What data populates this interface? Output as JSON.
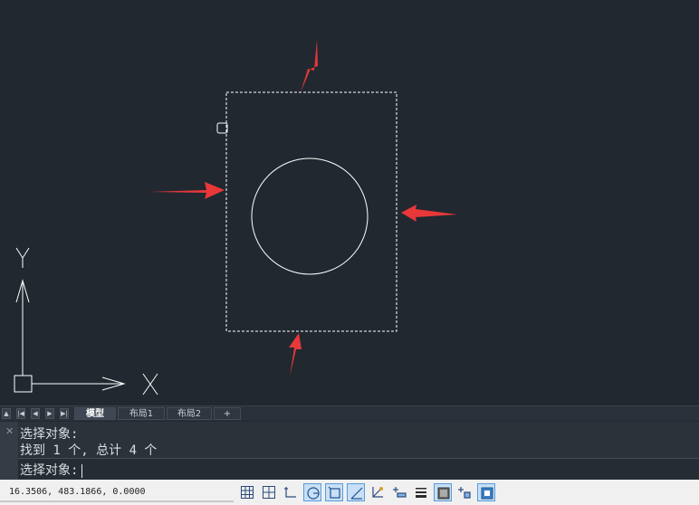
{
  "canvas": {
    "background": "#212830",
    "axis_x_label": "X",
    "axis_y_label": "Y"
  },
  "tabs": {
    "items": [
      "模型",
      "布局1",
      "布局2",
      "+"
    ],
    "active": "模型"
  },
  "command": {
    "history": [
      "选择对象:",
      "找到 1 个, 总计 4 个"
    ],
    "prompt": "选择对象:"
  },
  "status": {
    "coordinates": "16.3506, 483.1866, 0.0000",
    "buttons": [
      {
        "name": "grid-display",
        "icon": "grid-icon",
        "on": false
      },
      {
        "name": "snap-mode",
        "icon": "snap-grid-icon",
        "on": false
      },
      {
        "name": "ortho-mode",
        "icon": "ortho-icon",
        "on": false
      },
      {
        "name": "polar-tracking",
        "icon": "polar-icon",
        "on": true
      },
      {
        "name": "object-snap",
        "icon": "osnap-icon",
        "on": true
      },
      {
        "name": "object-snap-tracking",
        "icon": "otrack-icon",
        "on": true
      },
      {
        "name": "dynamic-ucs",
        "icon": "ducs-icon",
        "on": false
      },
      {
        "name": "dynamic-input",
        "icon": "dyn-input-icon",
        "on": false
      },
      {
        "name": "lineweight",
        "icon": "lineweight-icon",
        "on": false
      },
      {
        "name": "transparency",
        "icon": "transparency-icon",
        "on": true
      },
      {
        "name": "selection-cycling",
        "icon": "selection-cycling-icon",
        "on": false
      },
      {
        "name": "annotation-monitor",
        "icon": "annotation-icon",
        "on": true
      }
    ]
  }
}
